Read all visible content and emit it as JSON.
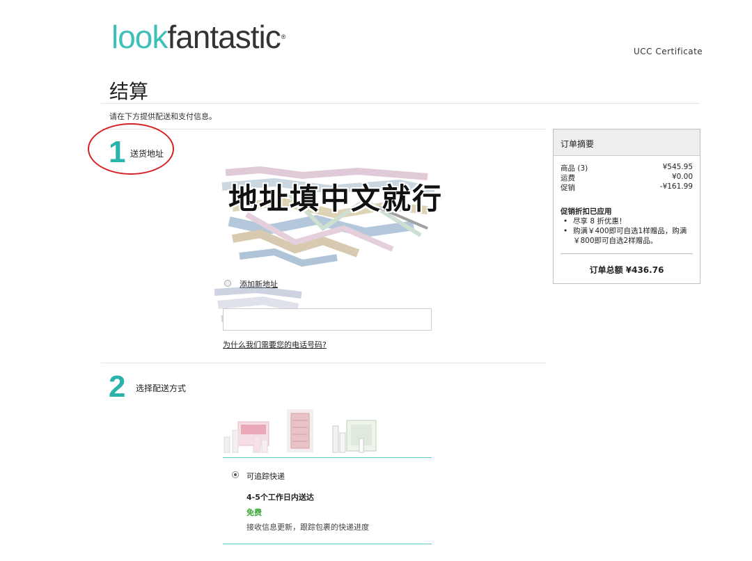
{
  "header": {
    "logo_look": "look",
    "logo_fantastic": "fantastic",
    "logo_reg": "®",
    "ucc": "UCC Certificate"
  },
  "page": {
    "title": "结算",
    "subtitle": "请在下方提供配送和支付信息。"
  },
  "step1": {
    "number": "1",
    "label": "送货地址",
    "overlay_text": "地址填中文就行",
    "add_address_label": "添加新地址",
    "phone_value": "",
    "phone_why_link": "为什么我们需要您的电话号码?"
  },
  "step2": {
    "number": "2",
    "label": "选择配送方式",
    "option_label": "可追踪快递",
    "option_time": "4-5个工作日内送达",
    "option_price": "免费",
    "option_desc": "接收信息更新，跟踪包裹的快递进度"
  },
  "summary": {
    "title": "订单摘要",
    "rows": [
      {
        "label": "商品 (3)",
        "value": "¥545.95"
      },
      {
        "label": "运费",
        "value": "¥0.00"
      },
      {
        "label": "促销",
        "value": "-¥161.99"
      }
    ],
    "promo_title": "促销折扣已应用",
    "promos": [
      "尽享 8 折优惠！",
      "购满￥400即可自选1样赠品，购满￥800即可自选2样赠品。"
    ],
    "total": "订单总额 ¥436.76"
  },
  "colors": {
    "brand_teal": "#3fbfba",
    "step_teal": "#2ab3ad",
    "free_green": "#3aa935",
    "annotation_red": "#d81f1f"
  }
}
